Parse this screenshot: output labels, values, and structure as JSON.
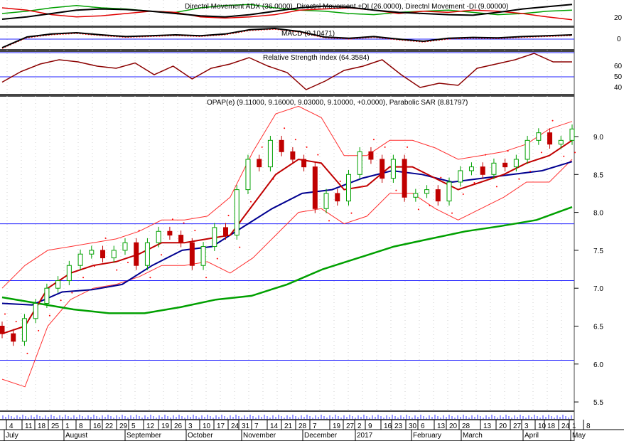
{
  "chart_data": {
    "type": "candlestick",
    "title": "OPAP(e) (9.11000, 9.16000, 9.03000, 9.10000, +0.0000), Parabolic SAR (8.81797)",
    "ylim": [
      5.4,
      9.5
    ],
    "yticks": [
      "9.0",
      "8.5",
      "8.0",
      "7.5",
      "7.0",
      "6.5",
      "6.0",
      "5.5"
    ],
    "ytick_values": [
      9.0,
      8.5,
      8.0,
      7.5,
      7.0,
      6.5,
      6.0,
      5.5
    ],
    "hlines": [
      7.85,
      7.1,
      6.05
    ],
    "closes": [
      6.4,
      6.3,
      6.6,
      6.8,
      7.0,
      7.1,
      7.3,
      7.45,
      7.5,
      7.4,
      7.5,
      7.6,
      7.3,
      7.6,
      7.75,
      7.7,
      7.6,
      7.3,
      7.55,
      7.8,
      7.7,
      8.3,
      8.7,
      8.6,
      8.95,
      8.8,
      8.7,
      8.6,
      8.05,
      8.25,
      8.15,
      8.5,
      8.8,
      8.7,
      8.45,
      8.7,
      8.2,
      8.25,
      8.3,
      8.15,
      8.4,
      8.55,
      8.6,
      8.5,
      8.65,
      8.6,
      8.7,
      8.95,
      9.05,
      8.9,
      8.95,
      9.1
    ],
    "ma_red": [
      6.4,
      6.5,
      7.0,
      7.2,
      7.3,
      7.35,
      7.45,
      7.6,
      7.6,
      7.65,
      7.7,
      8.1,
      8.5,
      8.7,
      8.65,
      8.3,
      8.35,
      8.6,
      8.6,
      8.45,
      8.3,
      8.4,
      8.5,
      8.65,
      8.75,
      8.95
    ],
    "ma_blue": [
      6.8,
      6.78,
      6.95,
      6.98,
      7.05,
      7.3,
      7.5,
      7.55,
      7.8,
      8.05,
      8.25,
      8.3,
      8.45,
      8.55,
      8.5,
      8.4,
      8.45,
      8.5,
      8.55,
      8.67
    ],
    "ma_green": [
      6.88,
      6.8,
      6.72,
      6.67,
      6.67,
      6.75,
      6.85,
      6.9,
      7.05,
      7.25,
      7.4,
      7.55,
      7.65,
      7.75,
      7.82,
      7.9,
      8.07
    ],
    "bollinger_width": [
      0.6,
      0.8,
      0.5,
      0.35,
      0.3,
      0.3,
      0.3,
      0.3,
      0.3,
      0.3,
      0.5,
      0.7,
      0.8,
      0.7,
      0.6,
      0.45,
      0.4,
      0.35,
      0.35,
      0.4,
      0.4,
      0.35,
      0.3,
      0.25,
      0.35,
      0.25
    ],
    "indicators": {
      "adx": {
        "label": "Directnl Movement ADX (36.0000), Directnl Movement +DI (26.0000), Directnl Movement -DI (9.00000)",
        "tick": "20",
        "adx_values": [
          10,
          14,
          20,
          26,
          28,
          27,
          24,
          20,
          16,
          14,
          18,
          24,
          30,
          33,
          31,
          26,
          22,
          20,
          18,
          17,
          22,
          28,
          32,
          36
        ],
        "plus_di": [
          20,
          24,
          30,
          34,
          30,
          28,
          24,
          22,
          30,
          34,
          36,
          30,
          26,
          24,
          20,
          18,
          22,
          24,
          26,
          22,
          18,
          20,
          24,
          26
        ],
        "minus_di": [
          30,
          26,
          18,
          14,
          16,
          20,
          24,
          22,
          14,
          12,
          14,
          18,
          26,
          28,
          30,
          26,
          20,
          24,
          22,
          26,
          24,
          20,
          14,
          9
        ]
      },
      "macd": {
        "label": "MACD (0.10471)",
        "tick": "0",
        "values": [
          -0.2,
          0.05,
          0.12,
          0.15,
          0.1,
          0.06,
          0.08,
          0.1,
          0.08,
          0.12,
          0.22,
          0.25,
          0.18,
          0.05,
          0.02,
          0.06,
          0.0,
          -0.05,
          0.02,
          0.04,
          0.03,
          0.06,
          0.08,
          0.1
        ]
      },
      "rsi": {
        "label": "Relative Strength Index (64.3584)",
        "ticks": [
          "60",
          "50",
          "40"
        ],
        "values": [
          45,
          55,
          62,
          66,
          64,
          60,
          58,
          63,
          52,
          60,
          48,
          58,
          62,
          68,
          60,
          54,
          38,
          46,
          56,
          60,
          66,
          52,
          40,
          44,
          42,
          58,
          62,
          66,
          72,
          64,
          64
        ]
      }
    },
    "x_day_labels": [
      "4",
      "11",
      "18",
      "25",
      "1",
      "8",
      "16",
      "22",
      "29",
      "5",
      "12",
      "19",
      "26",
      "3",
      "10",
      "17",
      "24",
      "31",
      "7",
      "14",
      "21",
      "28",
      "7",
      "19",
      "27",
      "2",
      "9",
      "16",
      "23",
      "30",
      "6",
      "13",
      "20",
      "28",
      "13",
      "20",
      "27",
      "3",
      "10",
      "18",
      "24",
      "1",
      "8"
    ],
    "x_month_labels": [
      "July",
      "August",
      "September",
      "October",
      "November",
      "December",
      "2017",
      "February",
      "March",
      "April",
      "May"
    ],
    "colors": {
      "up": "#00a000",
      "down": "#c00000",
      "ma_red": "#c00000",
      "ma_blue": "#000090",
      "ma_green": "#00a000",
      "band": "#ff3030",
      "hline": "#2020ff"
    }
  }
}
